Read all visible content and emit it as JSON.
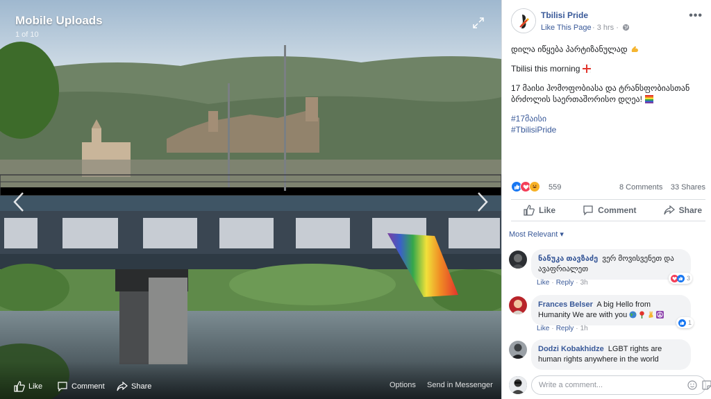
{
  "viewer": {
    "album_title": "Mobile Uploads",
    "photo_counter": "1 of 10",
    "actions": {
      "like": "Like",
      "comment": "Comment",
      "share": "Share",
      "options": "Options",
      "send_in_messenger": "Send in Messenger"
    }
  },
  "post": {
    "page_name": "Tbilisi Pride",
    "like_page": "Like This Page",
    "time": "· 3 hrs ·",
    "more": "•••",
    "text": {
      "line1": "დილა იწყება პარტიზანულად",
      "line2": "Tbilisi this morning",
      "line3a": "17 მაისი ჰომოფობიასა და ტრანსფობიასთან",
      "line3b": "ბრძოლის საერთაშორისო დღეა!",
      "hashtag1": "#17მაისი",
      "hashtag2": "#TbilisiPride"
    },
    "reaction_count": "559",
    "comments_count": "8 Comments",
    "shares_count": "33 Shares",
    "actions": {
      "like": "Like",
      "comment": "Comment",
      "share": "Share"
    }
  },
  "comments": {
    "sort_label": "Most Relevant ▾",
    "items": [
      {
        "name": "ნანუკა თავზაძე",
        "text": "ვერ მოვისვენეთ და ავაფრიალეთ",
        "like": "Like",
        "reply": "Reply",
        "time": "3h",
        "reactions": "3"
      },
      {
        "name": "Frances Belser",
        "text": "A big Hello from Humanity We are with you",
        "like": "Like",
        "reply": "Reply",
        "time": "1h",
        "reactions": "1"
      },
      {
        "name": "Dodzi Kobakhidze",
        "text": "LGBT rights are human rights anywhere in the world",
        "like": "Like",
        "reply": "Reply",
        "time": ""
      }
    ],
    "write_placeholder": "Write a comment..."
  },
  "colors": {
    "link": "#385898",
    "secondary": "#606770",
    "bubble": "#f2f3f5",
    "like_blue": "#1877f2",
    "love_red": "#f33e58",
    "haha_yellow": "#f7b125"
  }
}
